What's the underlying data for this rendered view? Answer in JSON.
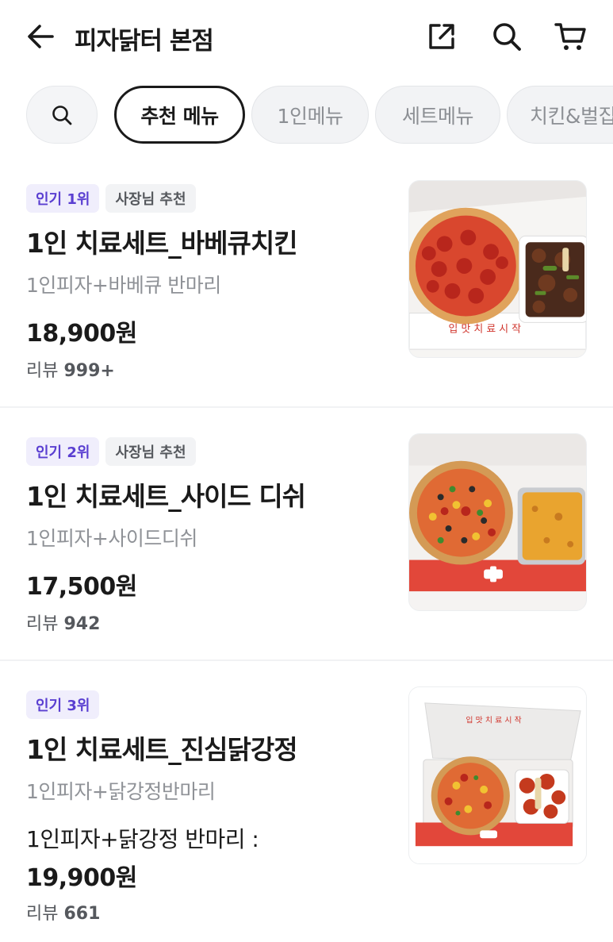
{
  "header": {
    "title": "피자닭터 본점",
    "back_icon": "arrow-left-icon",
    "share_icon": "share-icon",
    "search_icon": "search-icon",
    "cart_icon": "cart-icon"
  },
  "chips": {
    "search_icon": "search-icon",
    "items": [
      {
        "label": "추천 메뉴",
        "active": true
      },
      {
        "label": "1인메뉴",
        "active": false
      },
      {
        "label": "세트메뉴",
        "active": false
      },
      {
        "label": "치킨&벌집",
        "active": false
      }
    ]
  },
  "colors": {
    "rank_badge_bg": "#f0eefc",
    "rank_badge_text": "#5a3fd1",
    "owner_badge_bg": "#f2f3f5",
    "active_chip_border": "#1a1a1a"
  },
  "menu": [
    {
      "rank_badge": "인기 1위",
      "owner_badge": "사장님 추천",
      "name": "1인 치료세트_바베큐치킨",
      "description": "1인피자+바베큐 반마리",
      "price": "18,900원",
      "review_label": "리뷰",
      "review_count": "999+",
      "image": "pepperoni-pizza-bbq-chicken-box"
    },
    {
      "rank_badge": "인기 2위",
      "owner_badge": "사장님 추천",
      "name": "1인 치료세트_사이드 디쉬",
      "description": "1인피자+사이드디쉬",
      "price": "17,500원",
      "review_label": "리뷰",
      "review_count": "942",
      "image": "combo-pizza-cheese-side-box"
    },
    {
      "rank_badge": "인기 3위",
      "name": "1인 치료세트_진심닭강정",
      "description": "1인피자+닭강정반마리",
      "extra": "1인피자+닭강정 반마리 :",
      "price": "19,900원",
      "review_label": "리뷰",
      "review_count": "661",
      "image": "pizza-dakgangjeong-box"
    }
  ]
}
